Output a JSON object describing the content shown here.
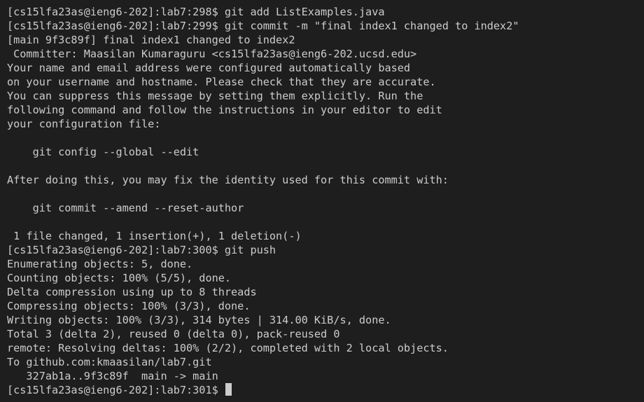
{
  "terminal": {
    "lines": [
      "[cs15lfa23as@ieng6-202]:lab7:298$ git add ListExamples.java",
      "[cs15lfa23as@ieng6-202]:lab7:299$ git commit -m \"final index1 changed to index2\"",
      "[main 9f3c89f] final index1 changed to index2",
      " Committer: Maasilan Kumaraguru <cs15lfa23as@ieng6-202.ucsd.edu>",
      "Your name and email address were configured automatically based",
      "on your username and hostname. Please check that they are accurate.",
      "You can suppress this message by setting them explicitly. Run the",
      "following command and follow the instructions in your editor to edit",
      "your configuration file:",
      "",
      "    git config --global --edit",
      "",
      "After doing this, you may fix the identity used for this commit with:",
      "",
      "    git commit --amend --reset-author",
      "",
      " 1 file changed, 1 insertion(+), 1 deletion(-)",
      "[cs15lfa23as@ieng6-202]:lab7:300$ git push",
      "Enumerating objects: 5, done.",
      "Counting objects: 100% (5/5), done.",
      "Delta compression using up to 8 threads",
      "Compressing objects: 100% (3/3), done.",
      "Writing objects: 100% (3/3), 314 bytes | 314.00 KiB/s, done.",
      "Total 3 (delta 2), reused 0 (delta 0), pack-reused 0",
      "remote: Resolving deltas: 100% (2/2), completed with 2 local objects.",
      "To github.com:kmaasilan/lab7.git",
      "   327ab1a..9f3c89f  main -> main"
    ],
    "prompt": "[cs15lfa23as@ieng6-202]:lab7:301$ "
  },
  "colors": {
    "background": "#1e1e1e",
    "foreground": "#cccccc",
    "cursor": "#cccccc"
  }
}
